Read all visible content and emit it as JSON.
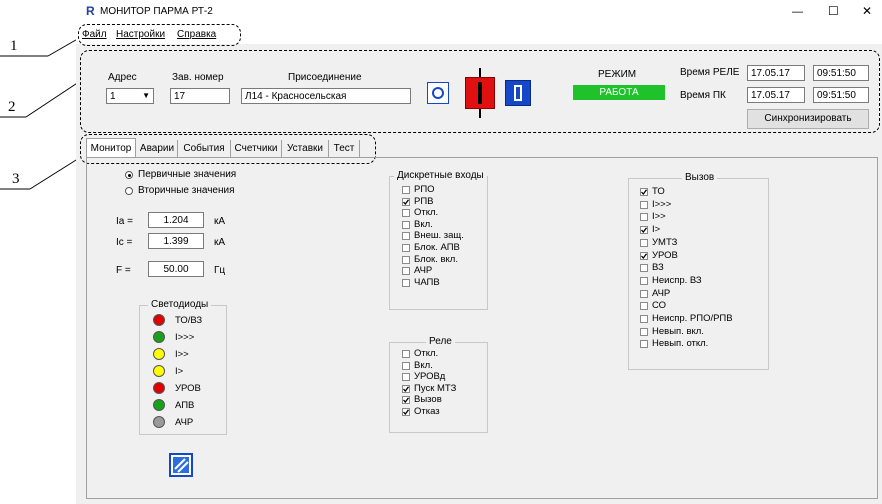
{
  "window": {
    "title": "МОНИТОР ПАРМА РТ-2",
    "min": "—",
    "max": "☐",
    "close": "✕"
  },
  "menu": {
    "file": "Файл",
    "settings": "Настройки",
    "help": "Справка"
  },
  "callouts": {
    "c1": "1",
    "c2": "2",
    "c3": "3"
  },
  "header": {
    "address_label": "Адрес",
    "address_value": "1",
    "serial_label": "Зав. номер",
    "serial_value": "17",
    "connection_label": "Присоединение",
    "connection_value": "Л14 - Красносельская",
    "mode_label": "РЕЖИМ",
    "mode_value": "РАБОТА",
    "relay_time_label": "Время РЕЛЕ",
    "relay_date": "17.05.17",
    "relay_time": "09:51:50",
    "pc_time_label": "Время ПК",
    "pc_date": "17.05.17",
    "pc_time": "09:51:50",
    "sync_button": "Синхронизировать"
  },
  "tabs": [
    "Монитор",
    "Аварии",
    "События",
    "Счетчики",
    "Уставки",
    "Тест"
  ],
  "values": {
    "primary_label": "Первичные значения",
    "secondary_label": "Вторичные значения",
    "selected": "primary",
    "ia": {
      "label": "Ia =",
      "value": "1.204",
      "unit": "кА"
    },
    "ic": {
      "label": "Ic =",
      "value": "1.399",
      "unit": "кА"
    },
    "f": {
      "label": "F =",
      "value": "50.00",
      "unit": "Гц"
    }
  },
  "leds": {
    "title": "Светодиоды",
    "items": [
      {
        "label": "ТО/ВЗ",
        "color": "#e00000"
      },
      {
        "label": "I>>>",
        "color": "#1aa11a"
      },
      {
        "label": "I>>",
        "color": "#ffff00"
      },
      {
        "label": "I>",
        "color": "#ffff00"
      },
      {
        "label": "УРОВ",
        "color": "#e00000"
      },
      {
        "label": "АПВ",
        "color": "#1aa11a"
      },
      {
        "label": "АЧР",
        "color": "#9a9a9a"
      }
    ]
  },
  "discrete_inputs": {
    "title": "Дискретные входы",
    "items": [
      {
        "label": "РПО",
        "checked": false
      },
      {
        "label": "РПВ",
        "checked": true
      },
      {
        "label": "Откл.",
        "checked": false
      },
      {
        "label": "Вкл.",
        "checked": false
      },
      {
        "label": "Внеш. защ.",
        "checked": false
      },
      {
        "label": "Блок. АПВ",
        "checked": false
      },
      {
        "label": "Блок. вкл.",
        "checked": false
      },
      {
        "label": "АЧР",
        "checked": false
      },
      {
        "label": "ЧАПВ",
        "checked": false
      }
    ]
  },
  "relay": {
    "title": "Реле",
    "items": [
      {
        "label": "Откл.",
        "checked": false
      },
      {
        "label": "Вкл.",
        "checked": false
      },
      {
        "label": "УРОВд",
        "checked": false
      },
      {
        "label": "Пуск МТЗ",
        "checked": true
      },
      {
        "label": "Вызов",
        "checked": true
      },
      {
        "label": "Отказ",
        "checked": true
      }
    ]
  },
  "call": {
    "title": "Вызов",
    "items": [
      {
        "label": "ТО",
        "checked": true
      },
      {
        "label": "I>>>",
        "checked": false
      },
      {
        "label": "I>>",
        "checked": false
      },
      {
        "label": "I>",
        "checked": true
      },
      {
        "label": "УМТЗ",
        "checked": false
      },
      {
        "label": "УРОВ",
        "checked": true
      },
      {
        "label": "ВЗ",
        "checked": false
      },
      {
        "label": "Неиспр. ВЗ",
        "checked": false
      },
      {
        "label": "АЧР",
        "checked": false
      },
      {
        "label": "СО",
        "checked": false
      },
      {
        "label": "Неиспр. РПО/РПВ",
        "checked": false
      },
      {
        "label": "Невып. вкл.",
        "checked": false
      },
      {
        "label": "Невып. откл.",
        "checked": false
      }
    ]
  },
  "colors": {
    "mode_green": "#1fc22b",
    "breaker_red": "#e01010",
    "icon_blue": "#1448c8"
  }
}
